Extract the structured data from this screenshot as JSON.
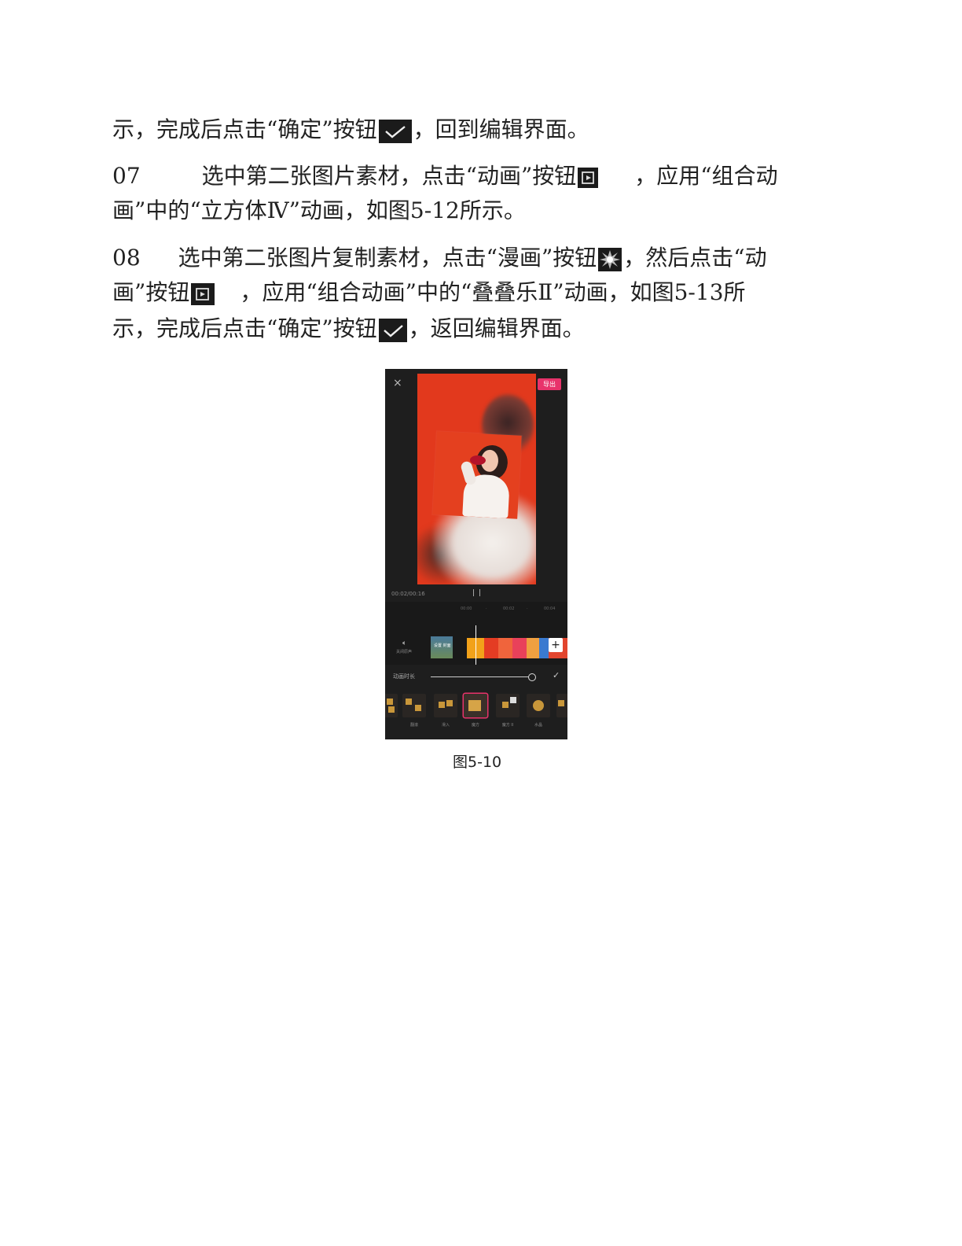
{
  "paragraphs": {
    "p1": {
      "text_a": "示，完成后点击“确定”按钮",
      "text_b": "，回到编辑界面。",
      "icon": "checkmark-icon"
    },
    "p2": {
      "step": "07",
      "line1_a": "选中第二张图片素材，点击“动画”按钮",
      "line1_b": "，应用“组合动",
      "line2": "画”中的“立方体Ⅳ”动画，如图5-12所示。",
      "icon": "animation-icon"
    },
    "p3": {
      "step": "08",
      "line1_a": "选中第二张图片复制素材，点击“漫画”按钮",
      "line1_b": "，然后点击“动",
      "line2_a": "画”按钮",
      "line2_b": "，应用“组合动画”中的“叠叠乐Ⅱ”动画，如图5-13所",
      "line3_a": "示，完成后点击“确定”按钮",
      "line3_b": "，返回编辑界面。",
      "icons": [
        "comic-icon",
        "animation-icon",
        "checkmark-icon"
      ]
    }
  },
  "figure": {
    "caption": "图5-10",
    "phone": {
      "close": "×",
      "export_label": "导出",
      "time": "00:02/00:16",
      "pause": "| |",
      "ruler": [
        "00:00",
        "·",
        "00:02",
        "·",
        "00:04"
      ],
      "mute_label": "关闭原声",
      "cover_label": "设置 封面",
      "add": "+",
      "duration_label": "动画时长",
      "animation_presets": [
        "",
        "翻滚",
        "滑入",
        "魔方",
        "魔方 II",
        "水晶",
        ""
      ],
      "selected_preset": "魔方",
      "accent_color": "#e8336b"
    }
  }
}
